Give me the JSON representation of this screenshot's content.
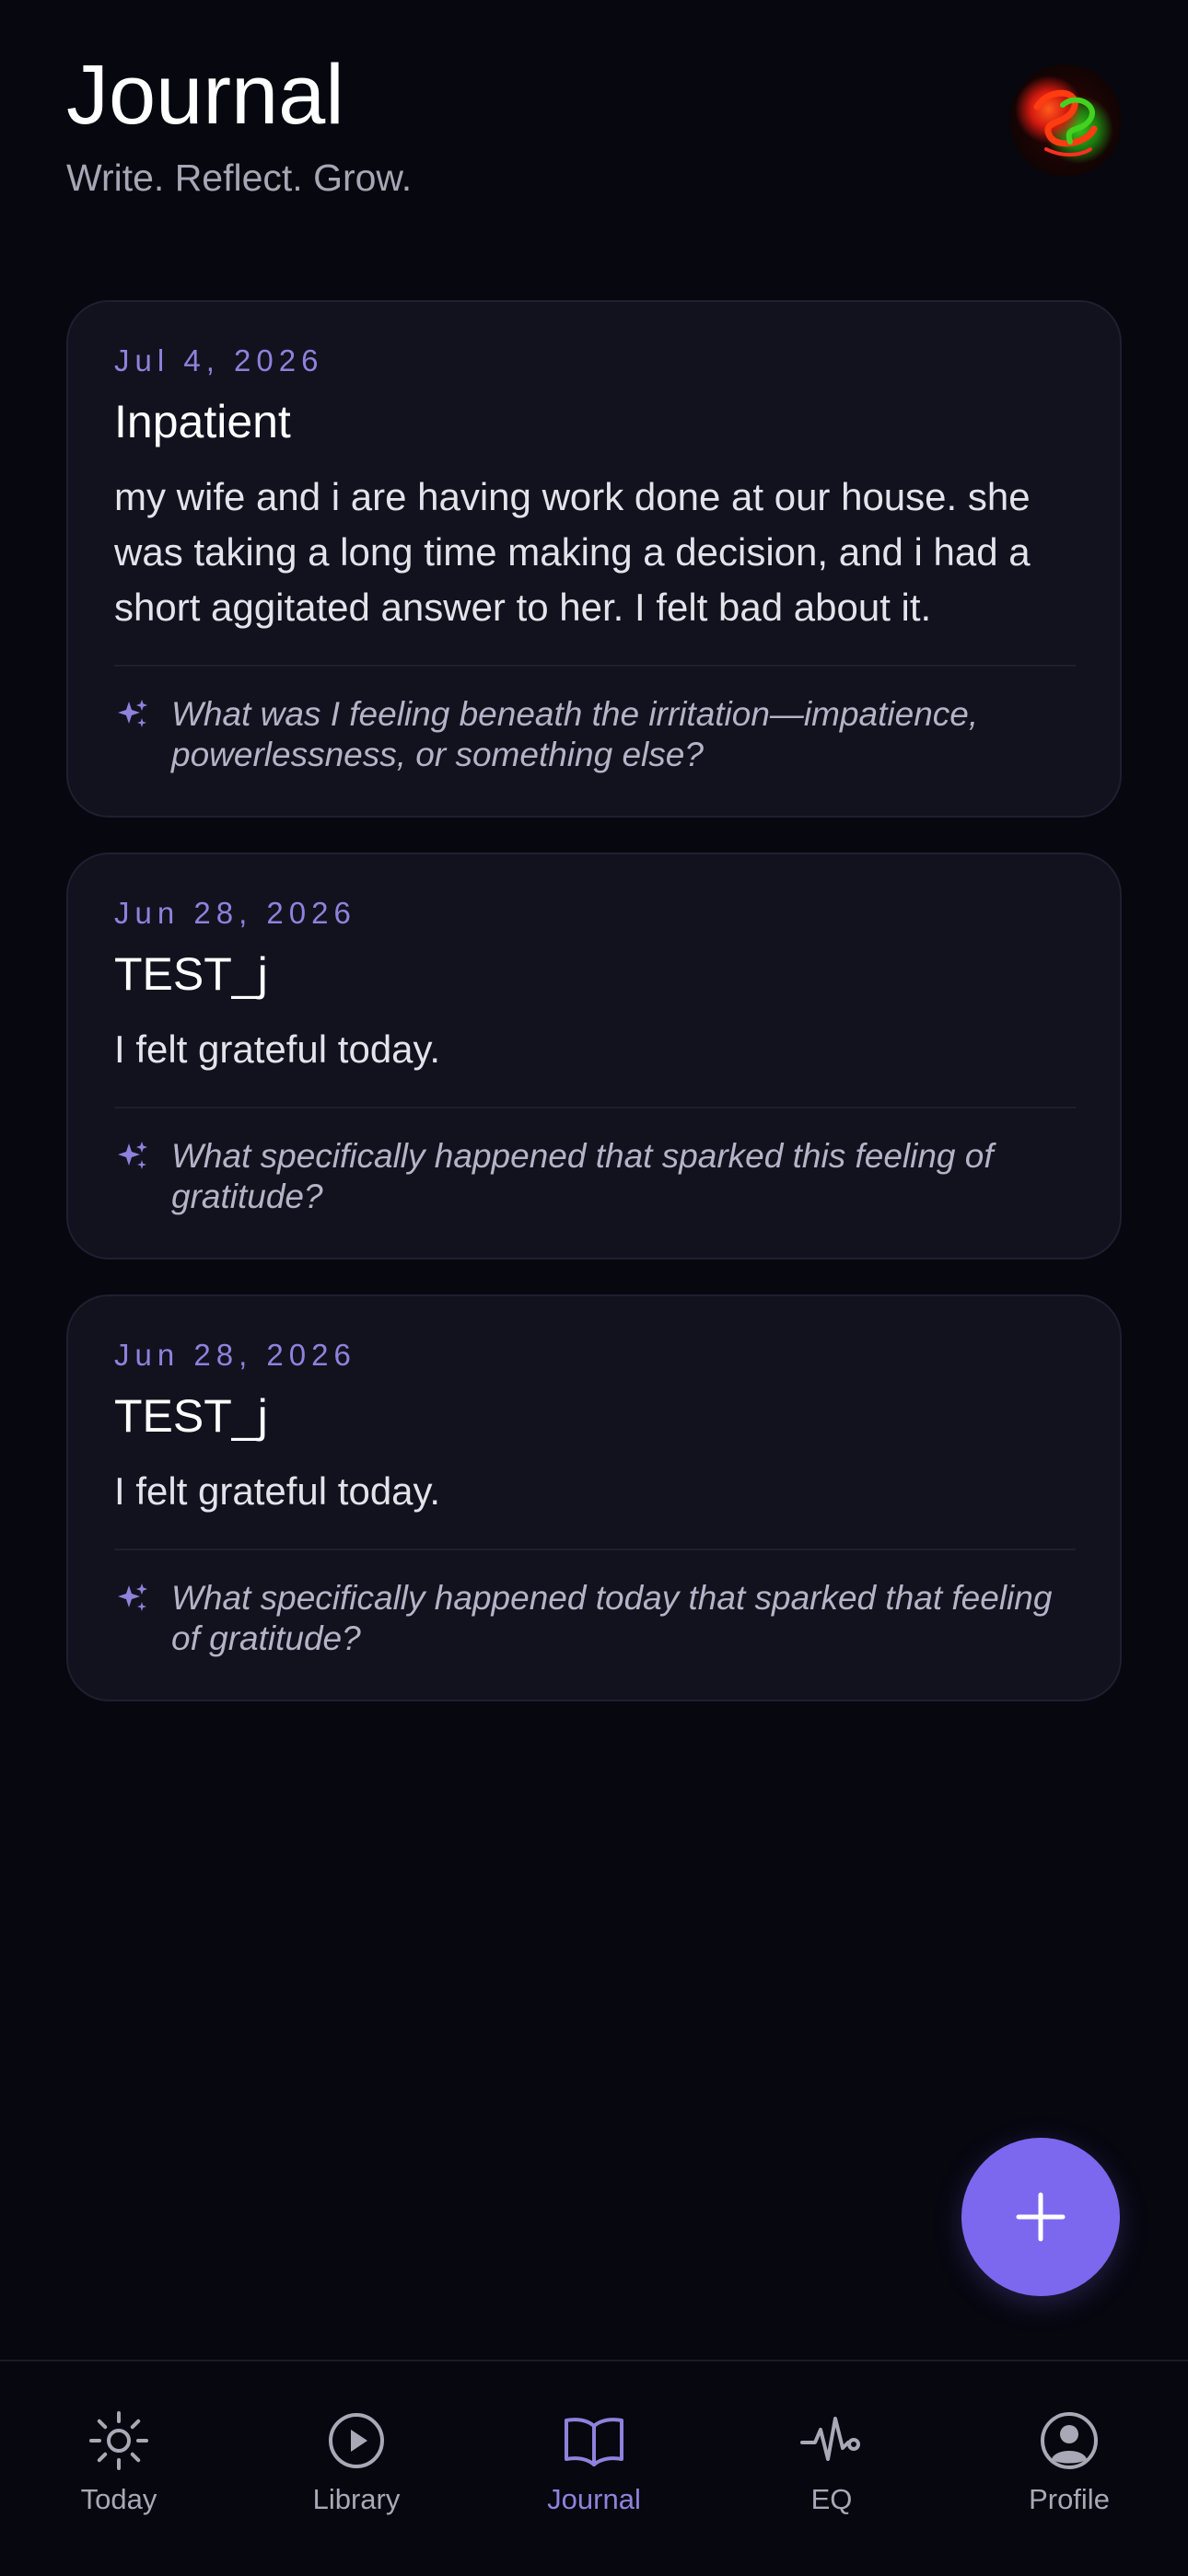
{
  "header": {
    "title": "Journal",
    "subtitle": "Write. Reflect. Grow."
  },
  "entries": [
    {
      "date": "Jul 4, 2026",
      "title": "Inpatient",
      "body": "my wife and i are having work done at our house.  she was taking a long time making a decision, and i had a short aggitated answer to her.  I felt bad about it.",
      "prompt": "What was I feeling beneath the irritation—impatience, powerlessness, or something else?"
    },
    {
      "date": "Jun 28, 2026",
      "title": "TEST_j",
      "body": "I felt grateful today.",
      "prompt": "What specifically happened that sparked this feeling of gratitude?"
    },
    {
      "date": "Jun 28, 2026",
      "title": "TEST_j",
      "body": "I felt grateful today.",
      "prompt": "What specifically happened today that sparked that feeling of gratitude?"
    }
  ],
  "fab": {
    "icon": "plus-icon"
  },
  "nav": {
    "items": [
      {
        "label": "Today",
        "icon": "sun-icon",
        "active": false
      },
      {
        "label": "Library",
        "icon": "play-circle-icon",
        "active": false
      },
      {
        "label": "Journal",
        "icon": "open-book-icon",
        "active": true
      },
      {
        "label": "EQ",
        "icon": "heartbeat-icon",
        "active": false
      },
      {
        "label": "Profile",
        "icon": "user-circle-icon",
        "active": false
      }
    ]
  },
  "colors": {
    "background": "#06070f",
    "card": "#11121e",
    "accent": "#7b68ee",
    "accent_text": "#8e82dc",
    "muted_text": "#a8a8b6"
  }
}
